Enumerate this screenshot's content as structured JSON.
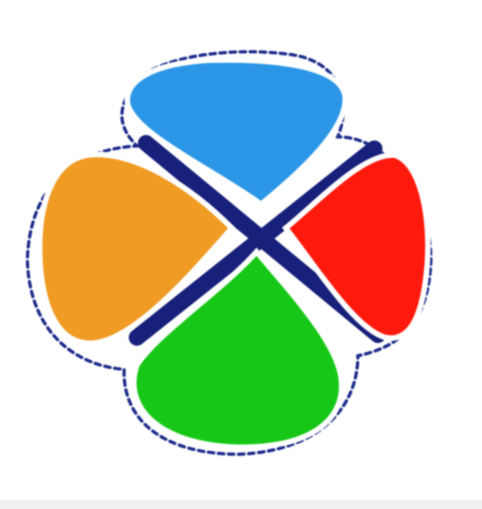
{
  "logo": {
    "icon": "four-leaf-clover-logo-icon",
    "colors": {
      "top_petal": "#2b96e6",
      "right_petal": "#ff1a0d",
      "bottom_petal": "#17c717",
      "left_petal": "#ef9b24",
      "cross": "#17207a",
      "outline": "#1c2b8a",
      "background": "#ffffff"
    }
  }
}
